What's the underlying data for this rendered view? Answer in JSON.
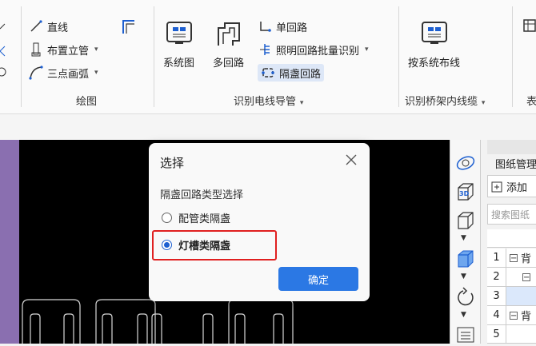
{
  "ribbon": {
    "draw_group": {
      "line": "直线",
      "riser": "布置立管",
      "arc": "三点画弧",
      "label": "绘图"
    },
    "circuit_group": {
      "system_diagram": "系统图",
      "multi_circuit": "多回路",
      "single_circuit": "单回路",
      "lighting_batch": "照明回路批量识别",
      "box_circuit": "隔盏回路",
      "label": "识别电线导管"
    },
    "tray_group": {
      "by_system": "按系统布线",
      "label": "识别桥架内线缆"
    },
    "cut_label": "表"
  },
  "dialog": {
    "title": "选择",
    "section": "隔盏回路类型选择",
    "options": [
      {
        "label": "配管类隔盏",
        "selected": false
      },
      {
        "label": "灯槽类隔盏",
        "selected": true
      }
    ],
    "ok": "确定",
    "highlight_color": "#e02020"
  },
  "right_panel": {
    "title": "图纸管理",
    "add": "添加",
    "search_placeholder": "搜索图纸",
    "rows": [
      {
        "num": "1",
        "text": "背"
      },
      {
        "num": "2",
        "text": ""
      },
      {
        "num": "3",
        "text": ""
      },
      {
        "num": "4",
        "text": "背"
      },
      {
        "num": "5",
        "text": ""
      }
    ]
  },
  "side_tools": [
    "orbit-icon",
    "3d-view-icon",
    "cube-icon",
    "cube-blue-icon",
    "rotate-icon",
    "list-icon"
  ],
  "side_tool_3d": "3D"
}
